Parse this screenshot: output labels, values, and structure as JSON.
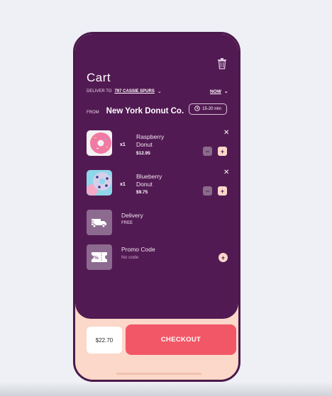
{
  "header": {
    "title": "Cart",
    "deliver_to_label": "DELIVER TO",
    "address": "797 CASSIE SPURS",
    "when": "NOW",
    "from_label": "FROM",
    "store_name": "New York Donut Co.",
    "time_estimate": "15-20 min"
  },
  "items": [
    {
      "name": "Raspberry Donut",
      "qty": "x1",
      "price": "$12.95",
      "image": "pink-donut"
    },
    {
      "name": "Blueberry Donut",
      "qty": "x1",
      "price": "$9.75",
      "image": "blue-donut"
    }
  ],
  "delivery": {
    "title": "Delivery",
    "subtitle": "FREE",
    "icon": "truck-icon"
  },
  "promo": {
    "title": "Promo Code",
    "subtitle": "No code",
    "icon": "coupon-icon",
    "badge": "%"
  },
  "footer": {
    "total": "$22.70",
    "checkout_label": "CHECKOUT"
  },
  "colors": {
    "panel": "#521a52",
    "accent": "#f25767",
    "peach": "#fbd8c9"
  }
}
